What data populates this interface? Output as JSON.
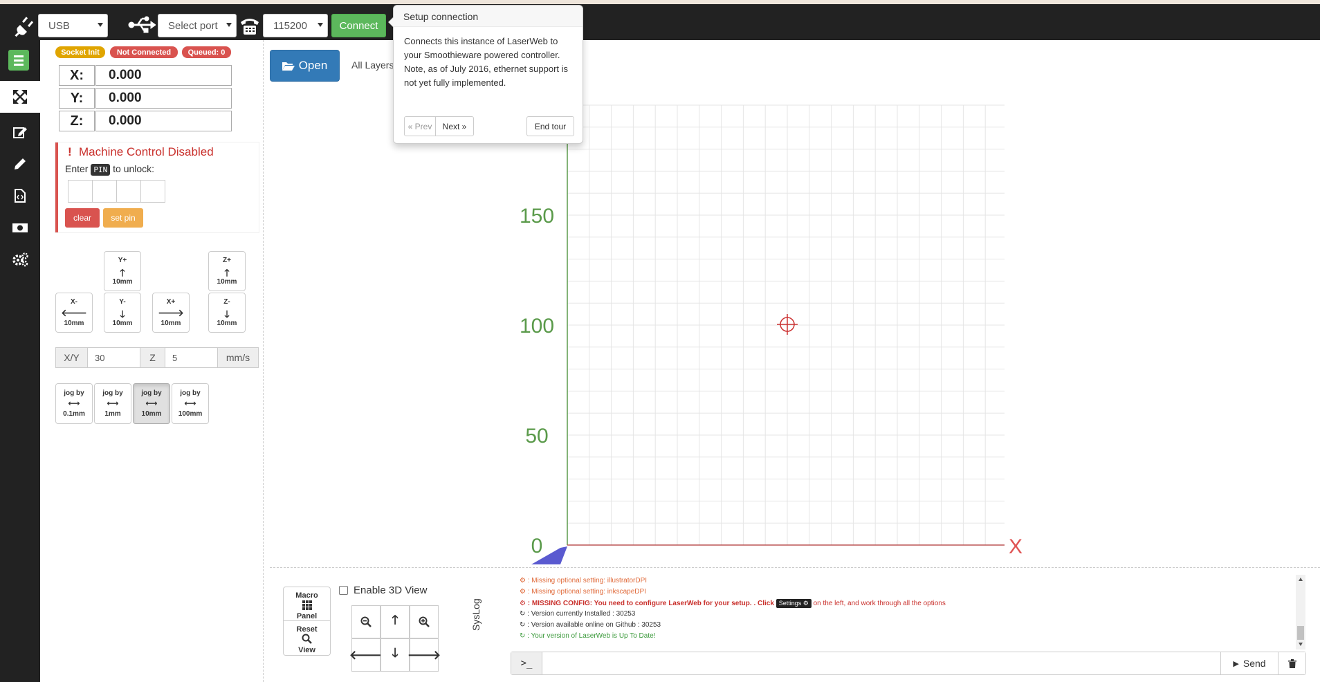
{
  "topbar": {
    "interface_select": "USB",
    "port_select": "Select port",
    "baud_select": "115200",
    "connect_label": "Connect"
  },
  "tour": {
    "title": "Setup connection",
    "content": "Connects this instance of LaserWeb to your Smoothieware powered controller. Note, as of July 2016, ethernet support is not yet fully implemented.",
    "prev_label": "« Prev",
    "next_label": "Next »",
    "end_label": "End tour"
  },
  "status": {
    "socket": "Socket Init",
    "connection": "Not Connected",
    "queued": "Queued: 0",
    "colors": {
      "socket": "#e0a500",
      "connection": "#d9534f",
      "queued": "#d9534f"
    }
  },
  "dro": {
    "x_label": "X:",
    "x_value": "0.000",
    "y_label": "Y:",
    "y_value": "0.000",
    "z_label": "Z:",
    "z_value": "0.000"
  },
  "machine_control": {
    "title": "Machine Control Disabled",
    "enter": "Enter",
    "pin": "PIN",
    "unlock": "to unlock:",
    "clear_label": "clear",
    "setpin_label": "set pin"
  },
  "jog": {
    "yplus": {
      "label": "Y+",
      "dist": "10mm"
    },
    "zplus": {
      "label": "Z+",
      "dist": "10mm"
    },
    "xminus": {
      "label": "X-",
      "dist": "10mm"
    },
    "yminus": {
      "label": "Y-",
      "dist": "10mm"
    },
    "xplus": {
      "label": "X+",
      "dist": "10mm"
    },
    "zminus": {
      "label": "Z-",
      "dist": "10mm"
    }
  },
  "speed": {
    "xy_label": "X/Y",
    "xy_value": "30",
    "z_label": "Z",
    "z_value": "5",
    "unit": "mm/s"
  },
  "jogby": [
    {
      "label": "jog by",
      "dist": "0.1mm"
    },
    {
      "label": "jog by",
      "dist": "1mm"
    },
    {
      "label": "jog by",
      "dist": "10mm",
      "active": true
    },
    {
      "label": "jog by",
      "dist": "100mm"
    }
  ],
  "workspace": {
    "open_label": "Open",
    "layers_label": "All Layers",
    "y_ticks": [
      "150",
      "100",
      "50",
      "0"
    ],
    "x_axis_label": "X",
    "axis_color": "#5a9a4a",
    "x_axis_color": "#e05555"
  },
  "viewer": {
    "macro_line1": "Macro",
    "macro_line2": "Panel",
    "reset_line1": "Reset",
    "reset_line2": "View",
    "enable3d_label": "Enable 3D View"
  },
  "syslog": {
    "label": "SysLog",
    "lines": [
      {
        "text": ": Missing optional setting: illustratorDPI",
        "color": "#e06a3a"
      },
      {
        "text": ": Missing optional setting: inkscapeDPI",
        "color": "#e06a3a"
      },
      {
        "text": ": MISSING CONFIG: You need to configure LaserWeb for your setup. . Click",
        "tail": "on the left, and work through all the options",
        "kbd": "Settings",
        "color": "#c9302c",
        "bold": true
      },
      {
        "text": ": Version currently Installed : 30253",
        "color": "#333333"
      },
      {
        "text": ": Version available online on Github : 30253",
        "color": "#333333"
      },
      {
        "text": ": Your version of LaserWeb is Up To Date!",
        "color": "#3c9a3c"
      }
    ]
  },
  "console": {
    "prompt": ">_",
    "send_label": "Send"
  }
}
